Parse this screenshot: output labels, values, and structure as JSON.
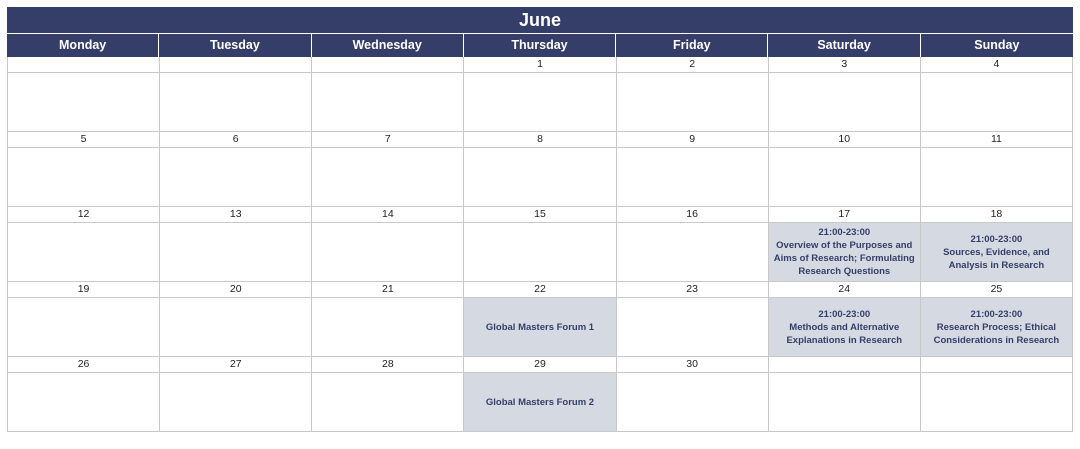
{
  "month": "June",
  "weekdays": [
    "Monday",
    "Tuesday",
    "Wednesday",
    "Thursday",
    "Friday",
    "Saturday",
    "Sunday"
  ],
  "weeks": [
    [
      {
        "day": "",
        "event": null
      },
      {
        "day": "",
        "event": null
      },
      {
        "day": "",
        "event": null
      },
      {
        "day": "1",
        "event": null
      },
      {
        "day": "2",
        "event": null
      },
      {
        "day": "3",
        "event": null
      },
      {
        "day": "4",
        "event": null
      }
    ],
    [
      {
        "day": "5",
        "event": null
      },
      {
        "day": "6",
        "event": null
      },
      {
        "day": "7",
        "event": null
      },
      {
        "day": "8",
        "event": null
      },
      {
        "day": "9",
        "event": null
      },
      {
        "day": "10",
        "event": null
      },
      {
        "day": "11",
        "event": null
      }
    ],
    [
      {
        "day": "12",
        "event": null
      },
      {
        "day": "13",
        "event": null
      },
      {
        "day": "14",
        "event": null
      },
      {
        "day": "15",
        "event": null
      },
      {
        "day": "16",
        "event": null
      },
      {
        "day": "17",
        "event": {
          "time": "21:00-23:00",
          "title": "Overview of the Purposes and Aims of Research; Formulating Research Questions"
        }
      },
      {
        "day": "18",
        "event": {
          "time": "21:00-23:00",
          "title": "Sources, Evidence, and Analysis in Research"
        }
      }
    ],
    [
      {
        "day": "19",
        "event": null
      },
      {
        "day": "20",
        "event": null
      },
      {
        "day": "21",
        "event": null
      },
      {
        "day": "22",
        "event": {
          "time": "",
          "title": "Global Masters Forum 1"
        }
      },
      {
        "day": "23",
        "event": null
      },
      {
        "day": "24",
        "event": {
          "time": "21:00-23:00",
          "title": "Methods and Alternative Explanations in Research"
        }
      },
      {
        "day": "25",
        "event": {
          "time": "21:00-23:00",
          "title": "Research Process; Ethical Considerations in Research"
        }
      }
    ],
    [
      {
        "day": "26",
        "event": null
      },
      {
        "day": "27",
        "event": null
      },
      {
        "day": "28",
        "event": null
      },
      {
        "day": "29",
        "event": {
          "time": "",
          "title": "Global Masters Forum 2"
        }
      },
      {
        "day": "30",
        "event": null
      },
      {
        "day": "",
        "event": null
      },
      {
        "day": "",
        "event": null
      }
    ]
  ],
  "colors": {
    "header_bg": "#353e68",
    "header_text": "#ffffff",
    "event_bg": "#d5dae2",
    "event_text": "#353e68",
    "grid_line": "#c8c8c8"
  }
}
